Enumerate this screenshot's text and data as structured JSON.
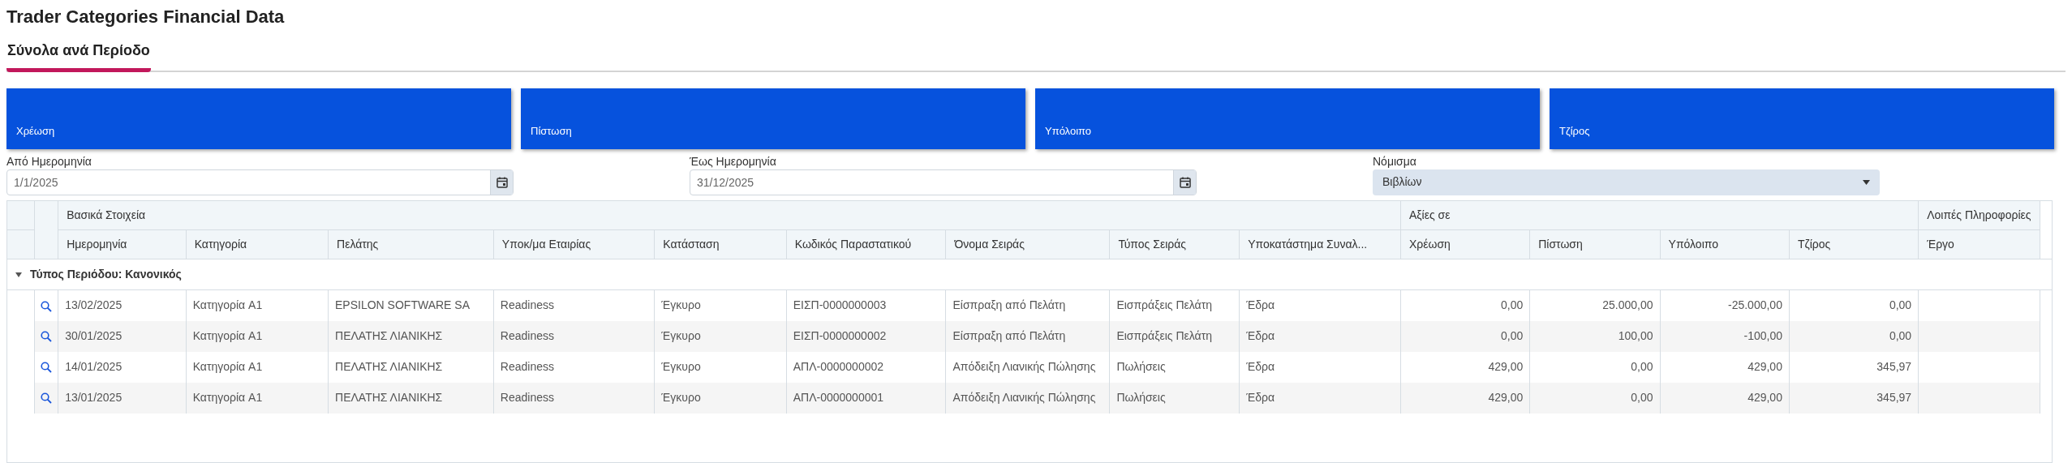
{
  "page_title": "Trader Categories Financial Data",
  "tabs": [
    {
      "label": "Σύνολα ανά Περίοδο",
      "selected": true
    }
  ],
  "cards": [
    {
      "label": "Χρέωση"
    },
    {
      "label": "Πίστωση"
    },
    {
      "label": "Υπόλοιπο"
    },
    {
      "label": "Τζίρος"
    }
  ],
  "filters": [
    {
      "kind": "date",
      "label": "Από Ημερομηνία",
      "value": "1/1/2025"
    },
    {
      "kind": "date",
      "label": "Έως Ημερομηνία",
      "value": "31/12/2025"
    },
    {
      "kind": "select",
      "label": "Νόμισμα",
      "value": "Βιβλίων"
    }
  ],
  "table": {
    "column_groups": [
      {
        "label": "Βασικά Στοιχεία",
        "columns": [
          {
            "label": "Ημερομηνία",
            "kind": "text"
          },
          {
            "label": "Κατηγορία",
            "kind": "text"
          },
          {
            "label": "Πελάτης",
            "kind": "text"
          },
          {
            "label": "Υποκ/μα Εταιρίας",
            "kind": "text"
          },
          {
            "label": "Κατάσταση",
            "kind": "text"
          },
          {
            "label": "Κωδικός Παραστατικού",
            "kind": "text"
          },
          {
            "label": "Όνομα Σειράς",
            "kind": "text"
          },
          {
            "label": "Τύπος Σειράς",
            "kind": "text"
          },
          {
            "label": "Υποκατάστημα Συναλ...",
            "kind": "text"
          }
        ]
      },
      {
        "label": "Αξίες σε",
        "columns": [
          {
            "label": "Χρέωση",
            "kind": "amount"
          },
          {
            "label": "Πίστωση",
            "kind": "amount"
          },
          {
            "label": "Υπόλοιπο",
            "kind": "amount"
          },
          {
            "label": "Τζίρος",
            "kind": "amount"
          }
        ]
      },
      {
        "label": "Λοιπές Πληροφορίες",
        "columns": [
          {
            "label": "Έργο",
            "kind": "text"
          }
        ]
      }
    ],
    "groups": [
      {
        "label": "Τύπος Περιόδου: Κανονικός",
        "expanded": true,
        "rows": [
          {
            "cells": [
              "13/02/2025",
              "Κατηγορία A1",
              "EPSILON SOFTWARE SA",
              "Readiness",
              "Έγκυρο",
              "ΕΙΣΠ-0000000003",
              "Είσπραξη από Πελάτη",
              "Εισπράξεις Πελάτη",
              "Έδρα",
              "0,00",
              "25.000,00",
              "-25.000,00",
              "0,00",
              ""
            ]
          },
          {
            "cells": [
              "30/01/2025",
              "Κατηγορία A1",
              "ΠΕΛΑΤΗΣ ΛΙΑΝΙΚΗΣ",
              "Readiness",
              "Έγκυρο",
              "ΕΙΣΠ-0000000002",
              "Είσπραξη από Πελάτη",
              "Εισπράξεις Πελάτη",
              "Έδρα",
              "0,00",
              "100,00",
              "-100,00",
              "0,00",
              ""
            ]
          },
          {
            "cells": [
              "14/01/2025",
              "Κατηγορία A1",
              "ΠΕΛΑΤΗΣ ΛΙΑΝΙΚΗΣ",
              "Readiness",
              "Έγκυρο",
              "ΑΠΛ-0000000002",
              "Απόδειξη Λιανικής Πώλησης",
              "Πωλήσεις",
              "Έδρα",
              "429,00",
              "0,00",
              "429,00",
              "345,97",
              ""
            ]
          },
          {
            "cells": [
              "13/01/2025",
              "Κατηγορία A1",
              "ΠΕΛΑΤΗΣ ΛΙΑΝΙΚΗΣ",
              "Readiness",
              "Έγκυρο",
              "ΑΠΛ-0000000001",
              "Απόδειξη Λιανικής Πώλησης",
              "Πωλήσεις",
              "Έδρα",
              "429,00",
              "0,00",
              "429,00",
              "345,97",
              ""
            ]
          }
        ]
      }
    ]
  }
}
